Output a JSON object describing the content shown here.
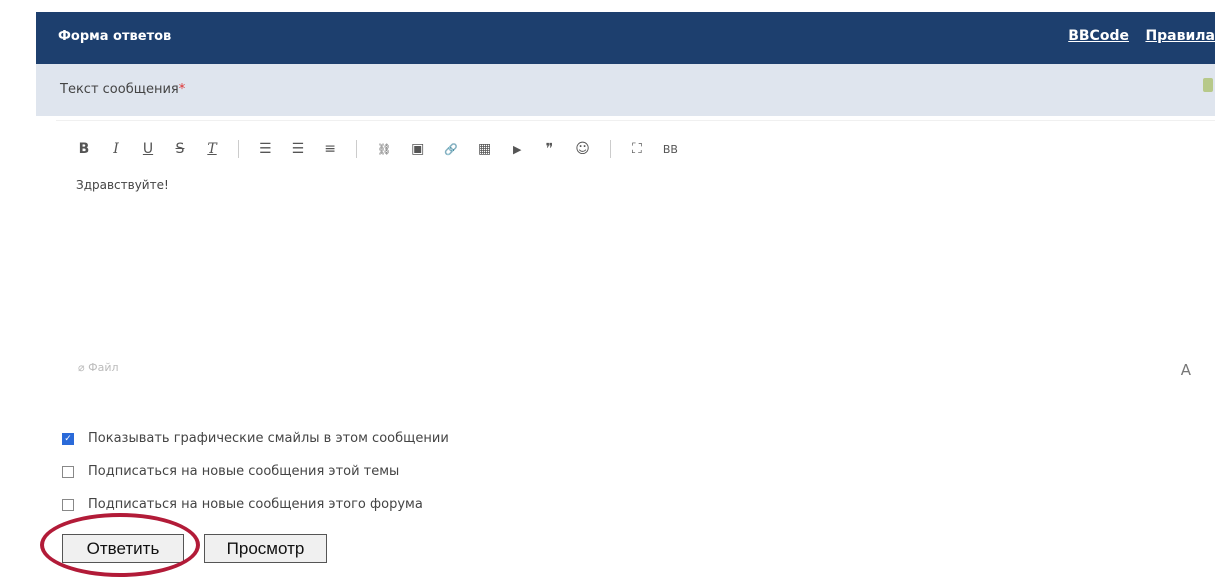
{
  "header": {
    "title": "Форма ответов",
    "links": [
      "BBCode",
      "Правила"
    ]
  },
  "subhead": {
    "label": "Текст сообщения",
    "required_mark": "*"
  },
  "toolbar": {
    "bold": "B",
    "italic": "I",
    "underline": "U",
    "strike": "S",
    "clear_format": "T",
    "ordered_list": "☰",
    "unordered_list": "☰",
    "align": "≡",
    "link_off": "⛓",
    "image": "▣",
    "link": "🔗",
    "media": "▦",
    "video": "▶",
    "quote": "❞",
    "emoji": "☺",
    "fullscreen": "⛶",
    "bbcode": "BB"
  },
  "editor": {
    "content": "Здравствуйте!",
    "attach_label": "Файл",
    "font_label": "A"
  },
  "options": [
    {
      "label": "Показывать графические смайлы в этом сообщении",
      "checked": true
    },
    {
      "label": "Подписаться на новые сообщения этой темы",
      "checked": false
    },
    {
      "label": "Подписаться на новые сообщения этого форума",
      "checked": false
    }
  ],
  "buttons": {
    "reply": "Ответить",
    "preview": "Просмотр"
  },
  "colors": {
    "header_bg": "#1d3f6e",
    "subhead_bg": "#dfe5ee",
    "highlight": "#b21b38",
    "checkbox": "#2a6ad9"
  }
}
